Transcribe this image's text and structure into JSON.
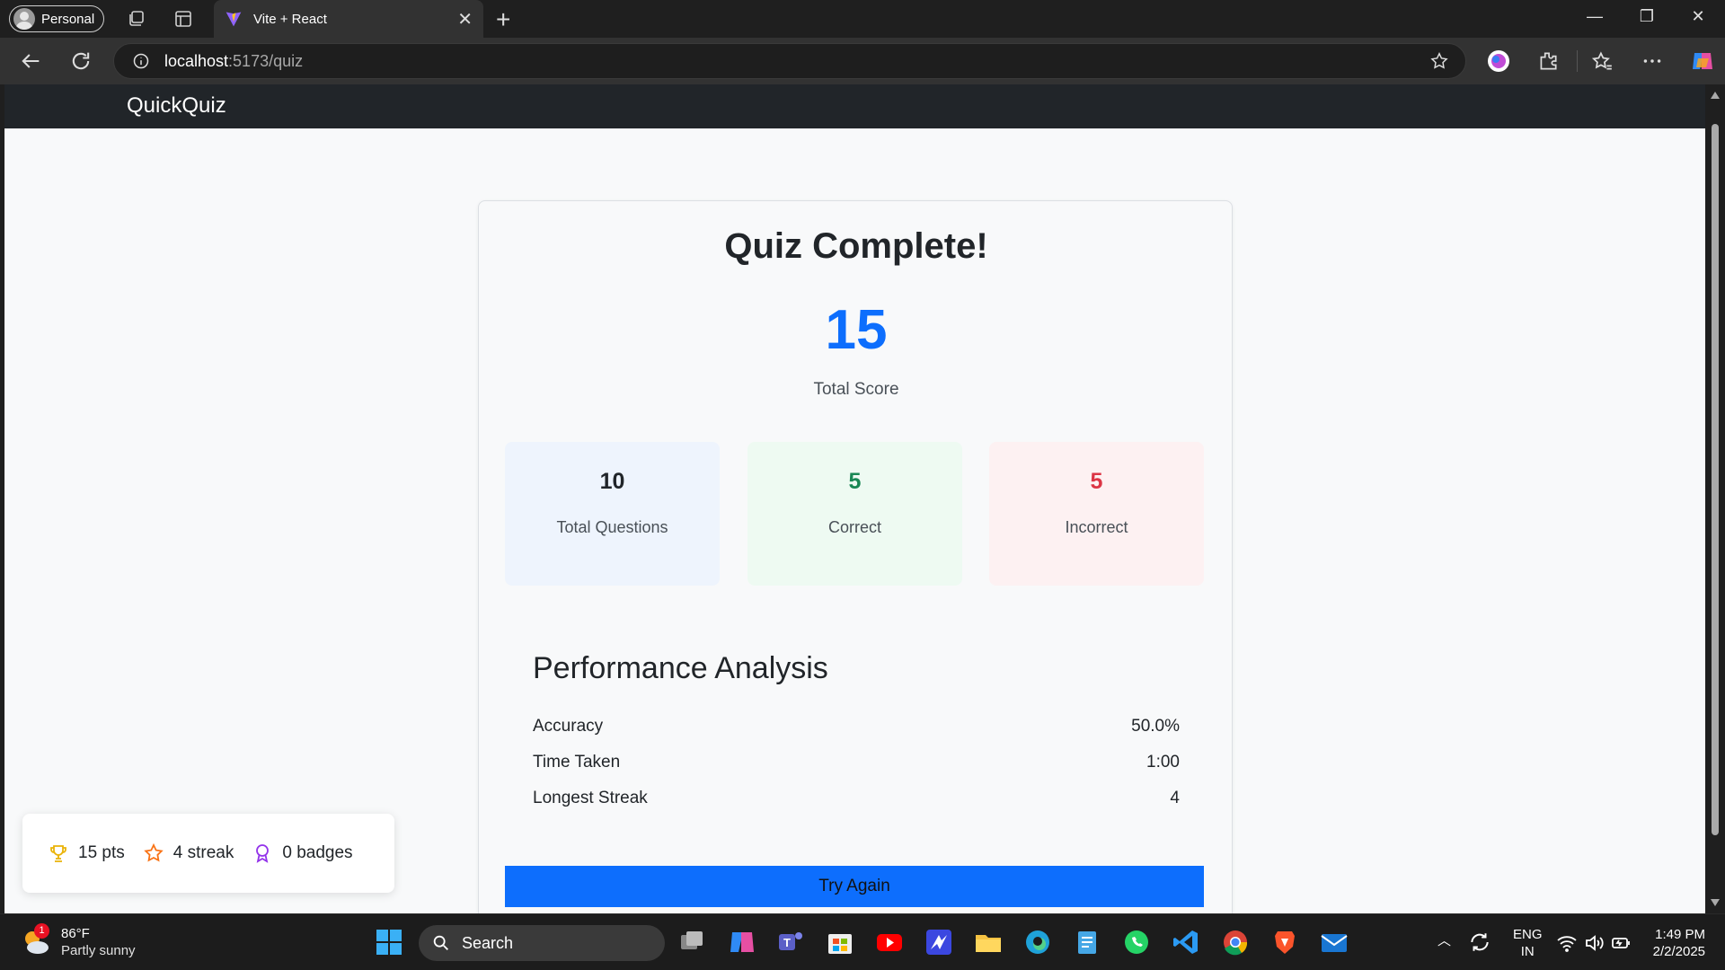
{
  "browser": {
    "profile_label": "Personal",
    "tab_title": "Vite + React",
    "url_host": "localhost",
    "url_path": ":5173/quiz"
  },
  "app": {
    "brand": "QuickQuiz"
  },
  "results": {
    "title": "Quiz Complete!",
    "score": "15",
    "score_label": "Total Score",
    "stats": [
      {
        "value": "10",
        "label": "Total Questions"
      },
      {
        "value": "5",
        "label": "Correct"
      },
      {
        "value": "5",
        "label": "Incorrect"
      }
    ],
    "performance_title": "Performance Analysis",
    "performance": [
      {
        "label": "Accuracy",
        "value": "50.0%"
      },
      {
        "label": "Time Taken",
        "value": "1:00"
      },
      {
        "label": "Longest Streak",
        "value": "4"
      }
    ],
    "try_again_label": "Try Again"
  },
  "stats_widget": {
    "points": "15 pts",
    "streak": "4 streak",
    "badges": "0 badges"
  },
  "colors": {
    "primary": "#0d6efd",
    "success": "#198754",
    "danger": "#dc3545",
    "navbar": "#212529"
  },
  "taskbar": {
    "weather_temp": "86°F",
    "weather_desc": "Partly sunny",
    "weather_badge": "1",
    "search_label": "Search",
    "lang_top": "ENG",
    "lang_bottom": "IN",
    "time": "1:49 PM",
    "date": "2/2/2025"
  }
}
